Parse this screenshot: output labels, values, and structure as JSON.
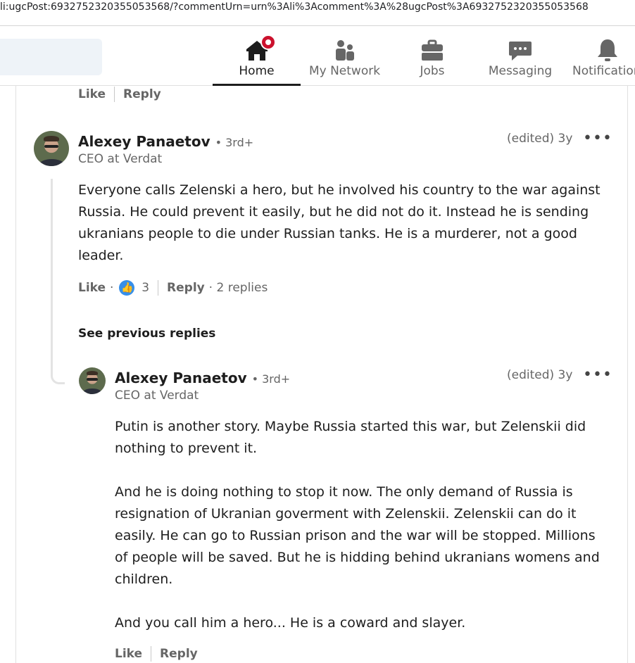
{
  "browser": {
    "url": "li:ugcPost:6932752320355053568/?commentUrn=urn%3Ali%3Acomment%3A%28ugcPost%3A6932752320355053568"
  },
  "nav": {
    "items": [
      {
        "label": "Home",
        "icon": "home-icon",
        "active": true
      },
      {
        "label": "My Network",
        "icon": "network-icon"
      },
      {
        "label": "Jobs",
        "icon": "briefcase-icon"
      },
      {
        "label": "Messaging",
        "icon": "chat-icon"
      },
      {
        "label": "Notifications",
        "icon": "bell-icon"
      }
    ]
  },
  "top_actions": {
    "like": "Like",
    "reply": "Reply"
  },
  "comment": {
    "author": "Alexey Panaetov",
    "degree": "• 3rd+",
    "headline": "CEO at Verdat",
    "meta": "(edited) 3y",
    "more": "•••",
    "text": "Everyone calls Zelenski a hero, but he involved his country to the war against Russia. He could prevent it easily, but he did not do it. Instead he is sending ukranians people to die under Russian tanks. He is a murderer, not a good leader.",
    "like": "Like",
    "dot": "·",
    "reactions": "3",
    "reply": "Reply",
    "replies": "· 2 replies"
  },
  "see_previous": "See previous replies",
  "reply": {
    "author": "Alexey Panaetov",
    "degree": "• 3rd+",
    "headline": "CEO at Verdat",
    "meta": "(edited) 3y",
    "more": "•••",
    "paragraphs": [
      "Putin is another story. Maybe Russia started this war, but Zelenskii did nothing to prevent it.",
      "And he is doing nothing to stop it now. The only demand of Russia is resignation of Ukranian goverment with Zelenskii. Zelenskii can do it easily. He can go to Russian prison and the war will be stopped. Millions of people will be saved. But he is hidding behind ukranians womens and children.",
      "And you call him a hero... He is a coward and slayer."
    ],
    "like": "Like",
    "reply": "Reply"
  }
}
